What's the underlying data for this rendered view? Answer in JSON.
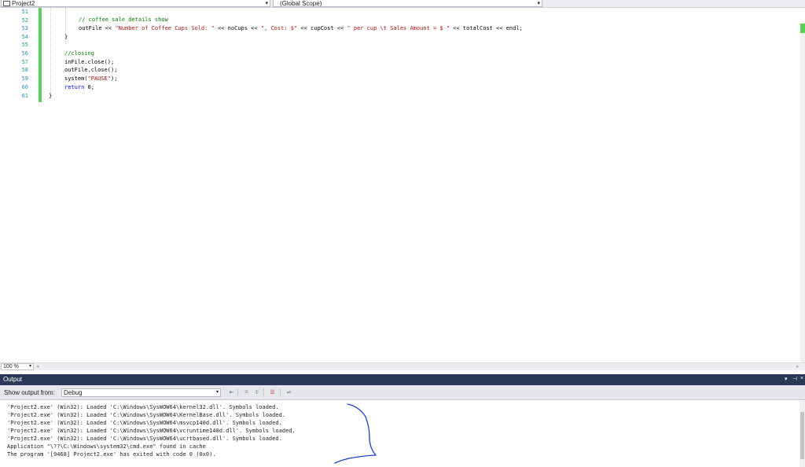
{
  "navbar": {
    "project": "Project2",
    "scope": "(Global Scope)"
  },
  "editor": {
    "line_numbers": [
      "51",
      "52",
      "53",
      "54",
      "55",
      "56",
      "57",
      "58",
      "59",
      "60",
      "61"
    ],
    "lines": {
      "l52_comment": "// coffee sale details show",
      "l53_a": "outFile << ",
      "l53_s1": "\"Number of Coffee Cups Sold: \"",
      "l53_b": " << noCups << ",
      "l53_s2": "\", Cost: $\"",
      "l53_c": " << cupCost << ",
      "l53_s3": "\" per cup \\t Sales Amount = $ \"",
      "l53_d": " << totalCost << endl;",
      "l54": "}",
      "l56_comment": "//closing",
      "l57": "inFile.close();",
      "l58": "outFile.close();",
      "l59_a": "system(",
      "l59_s": "\"PAUSE\"",
      "l59_b": ");",
      "l60_kw": "return",
      "l60_rest": " 0;",
      "l61": "}"
    }
  },
  "zoom": {
    "level": "100 %"
  },
  "output": {
    "title": "Output",
    "show_output_from_label": "Show output from:",
    "source": "Debug",
    "lines": [
      "'Project2.exe' (Win32): Loaded 'C:\\Windows\\SysWOW64\\kernel32.dll'. Symbols loaded.",
      "'Project2.exe' (Win32): Loaded 'C:\\Windows\\SysWOW64\\KernelBase.dll'. Symbols loaded.",
      "'Project2.exe' (Win32): Loaded 'C:\\Windows\\SysWOW64\\msvcp140d.dll'. Symbols loaded.",
      "'Project2.exe' (Win32): Loaded 'C:\\Windows\\SysWOW64\\vcruntime140d.dll'. Symbols loaded.",
      "'Project2.exe' (Win32): Loaded 'C:\\Windows\\SysWOW64\\ucrtbased.dll'. Symbols loaded.",
      "Application \"\\??\\C:\\Windows\\system32\\cmd.exe\" found in cache",
      "The program '[9468] Project2.exe' has exited with code 0 (0x0)."
    ]
  },
  "colors": {
    "output_header": "#293955",
    "change_bar": "#57d057",
    "annotation_ink": "#1a3fd0",
    "comment": "#008000",
    "string": "#a31515",
    "keyword": "#0000ff",
    "line_number": "#2b91af"
  }
}
